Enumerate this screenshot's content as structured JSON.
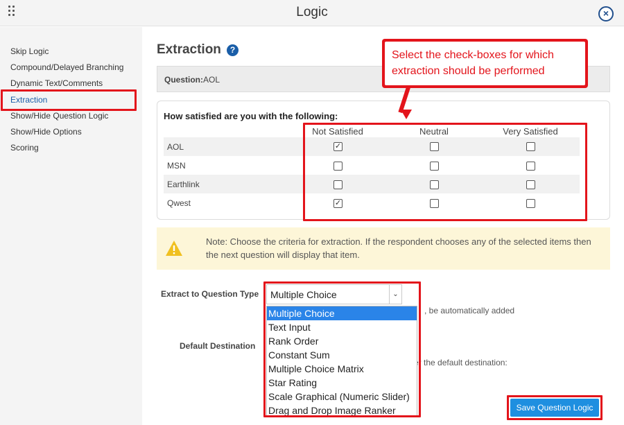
{
  "window": {
    "title": "Logic",
    "close_icon": "close-circle-icon"
  },
  "sidebar": {
    "items": [
      {
        "label": "Skip Logic"
      },
      {
        "label": "Compound/Delayed Branching"
      },
      {
        "label": "Dynamic Text/Comments"
      },
      {
        "label": "Extraction",
        "active": true
      },
      {
        "label": "Show/Hide Question Logic"
      },
      {
        "label": "Show/Hide Options"
      },
      {
        "label": "Scoring"
      }
    ]
  },
  "main": {
    "heading": "Extraction",
    "help_icon": "question-circle-icon",
    "question_label": "Question:",
    "question_value": "AOL",
    "callout": "Select the check-boxes for which extraction should be performed",
    "matrix": {
      "question": "How satisfied are you with the following:",
      "columns": [
        "Not Satisfied",
        "Neutral",
        "Very Satisfied"
      ],
      "rows": [
        {
          "label": "AOL",
          "checked": [
            true,
            false,
            false
          ]
        },
        {
          "label": "MSN",
          "checked": [
            false,
            false,
            false
          ]
        },
        {
          "label": "Earthlink",
          "checked": [
            false,
            false,
            false
          ]
        },
        {
          "label": "Qwest",
          "checked": [
            true,
            false,
            false
          ]
        }
      ]
    },
    "note": "Note: Choose the criteria for extraction. If the respondent chooses any of the selected items then the next question will display that item.",
    "extract_label": "Extract to Question Type",
    "extract_selected": "Multiple Choice",
    "extract_options": [
      "Multiple Choice",
      "Text Input",
      "Rank Order",
      "Constant Sum",
      "Multiple Choice Matrix",
      "Star Rating",
      "Scale Graphical (Numeric Slider)",
      "Drag and Drop Image Ranker"
    ],
    "partial_text_1": ", be automatically added",
    "default_destination_label": "Default Destination",
    "partial_text_2": "er the default destination:",
    "save_button": "Save Question Logic"
  },
  "colors": {
    "accent": "#1a5ea8",
    "annotation": "#e3141b",
    "highlight": "#2a84e8",
    "note_bg": "#fdf6d8"
  }
}
